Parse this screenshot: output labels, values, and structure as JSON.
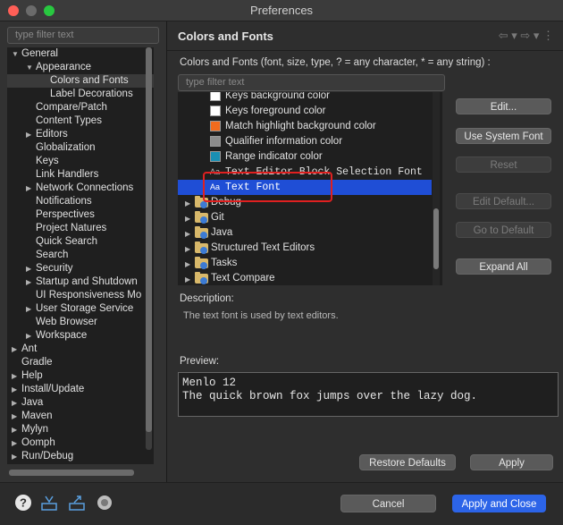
{
  "window": {
    "title": "Preferences"
  },
  "left": {
    "filter_placeholder": "type filter text",
    "tree": [
      {
        "label": "General",
        "depth": 0,
        "arrow": "down"
      },
      {
        "label": "Appearance",
        "depth": 1,
        "arrow": "down"
      },
      {
        "label": "Colors and Fonts",
        "depth": 2,
        "arrow": "",
        "selected": true
      },
      {
        "label": "Label Decorations",
        "depth": 2,
        "arrow": ""
      },
      {
        "label": "Compare/Patch",
        "depth": 1,
        "arrow": ""
      },
      {
        "label": "Content Types",
        "depth": 1,
        "arrow": ""
      },
      {
        "label": "Editors",
        "depth": 1,
        "arrow": "right"
      },
      {
        "label": "Globalization",
        "depth": 1,
        "arrow": ""
      },
      {
        "label": "Keys",
        "depth": 1,
        "arrow": ""
      },
      {
        "label": "Link Handlers",
        "depth": 1,
        "arrow": ""
      },
      {
        "label": "Network Connections",
        "depth": 1,
        "arrow": "right"
      },
      {
        "label": "Notifications",
        "depth": 1,
        "arrow": ""
      },
      {
        "label": "Perspectives",
        "depth": 1,
        "arrow": ""
      },
      {
        "label": "Project Natures",
        "depth": 1,
        "arrow": ""
      },
      {
        "label": "Quick Search",
        "depth": 1,
        "arrow": ""
      },
      {
        "label": "Search",
        "depth": 1,
        "arrow": ""
      },
      {
        "label": "Security",
        "depth": 1,
        "arrow": "right"
      },
      {
        "label": "Startup and Shutdown",
        "depth": 1,
        "arrow": "right"
      },
      {
        "label": "UI Responsiveness Mo",
        "depth": 1,
        "arrow": ""
      },
      {
        "label": "User Storage Service",
        "depth": 1,
        "arrow": "right"
      },
      {
        "label": "Web Browser",
        "depth": 1,
        "arrow": ""
      },
      {
        "label": "Workspace",
        "depth": 1,
        "arrow": "right"
      },
      {
        "label": "Ant",
        "depth": 0,
        "arrow": "right"
      },
      {
        "label": "Gradle",
        "depth": 0,
        "arrow": ""
      },
      {
        "label": "Help",
        "depth": 0,
        "arrow": "right"
      },
      {
        "label": "Install/Update",
        "depth": 0,
        "arrow": "right"
      },
      {
        "label": "Java",
        "depth": 0,
        "arrow": "right"
      },
      {
        "label": "Maven",
        "depth": 0,
        "arrow": "right"
      },
      {
        "label": "Mylyn",
        "depth": 0,
        "arrow": "right"
      },
      {
        "label": "Oomph",
        "depth": 0,
        "arrow": "right"
      },
      {
        "label": "Run/Debug",
        "depth": 0,
        "arrow": "right"
      }
    ]
  },
  "page": {
    "title": "Colors and Fonts",
    "nav_icons": "⇦ ▾  ⇨ ▾  ⋮",
    "intro": "Colors and Fonts (font, size, type, ? = any character, * = any string) :",
    "filter_placeholder": "type filter text",
    "font_tree": [
      {
        "label": "Keys background color",
        "kind": "color",
        "color": "#ffffff"
      },
      {
        "label": "Keys foreground color",
        "kind": "color",
        "color": "#ffffff"
      },
      {
        "label": "Match highlight background color",
        "kind": "color",
        "color": "#f26b1d"
      },
      {
        "label": "Qualifier information color",
        "kind": "color",
        "color": "#8c8c8c"
      },
      {
        "label": "Range indicator color",
        "kind": "color",
        "color": "#1a8fb3"
      },
      {
        "label": "Text Editor Block Selection Font",
        "kind": "font"
      },
      {
        "label": "Text Font",
        "kind": "font",
        "selected": true
      },
      {
        "label": "Debug",
        "kind": "folder"
      },
      {
        "label": "Git",
        "kind": "folder"
      },
      {
        "label": "Java",
        "kind": "folder"
      },
      {
        "label": "Structured Text Editors",
        "kind": "folder"
      },
      {
        "label": "Tasks",
        "kind": "folder"
      },
      {
        "label": "Text Compare",
        "kind": "folder"
      }
    ],
    "buttons": {
      "edit": "Edit...",
      "use_system_font": "Use System Font",
      "reset": "Reset",
      "edit_default": "Edit Default...",
      "go_to_default": "Go to Default",
      "expand_all": "Expand All"
    },
    "description_label": "Description:",
    "description_text": "The text font is used by text editors.",
    "preview_label": "Preview:",
    "preview_lines": [
      "Menlo 12",
      "The quick brown fox jumps over the lazy dog."
    ],
    "restore_defaults": "Restore Defaults",
    "apply": "Apply"
  },
  "bottom": {
    "cancel": "Cancel",
    "apply_and_close": "Apply and Close",
    "icons": [
      "help-icon",
      "import-icon",
      "export-icon",
      "record-icon"
    ]
  },
  "colors": {
    "accent": "#2c64e8",
    "selection": "#1f4ed6",
    "highlight_box": "#e02020"
  }
}
